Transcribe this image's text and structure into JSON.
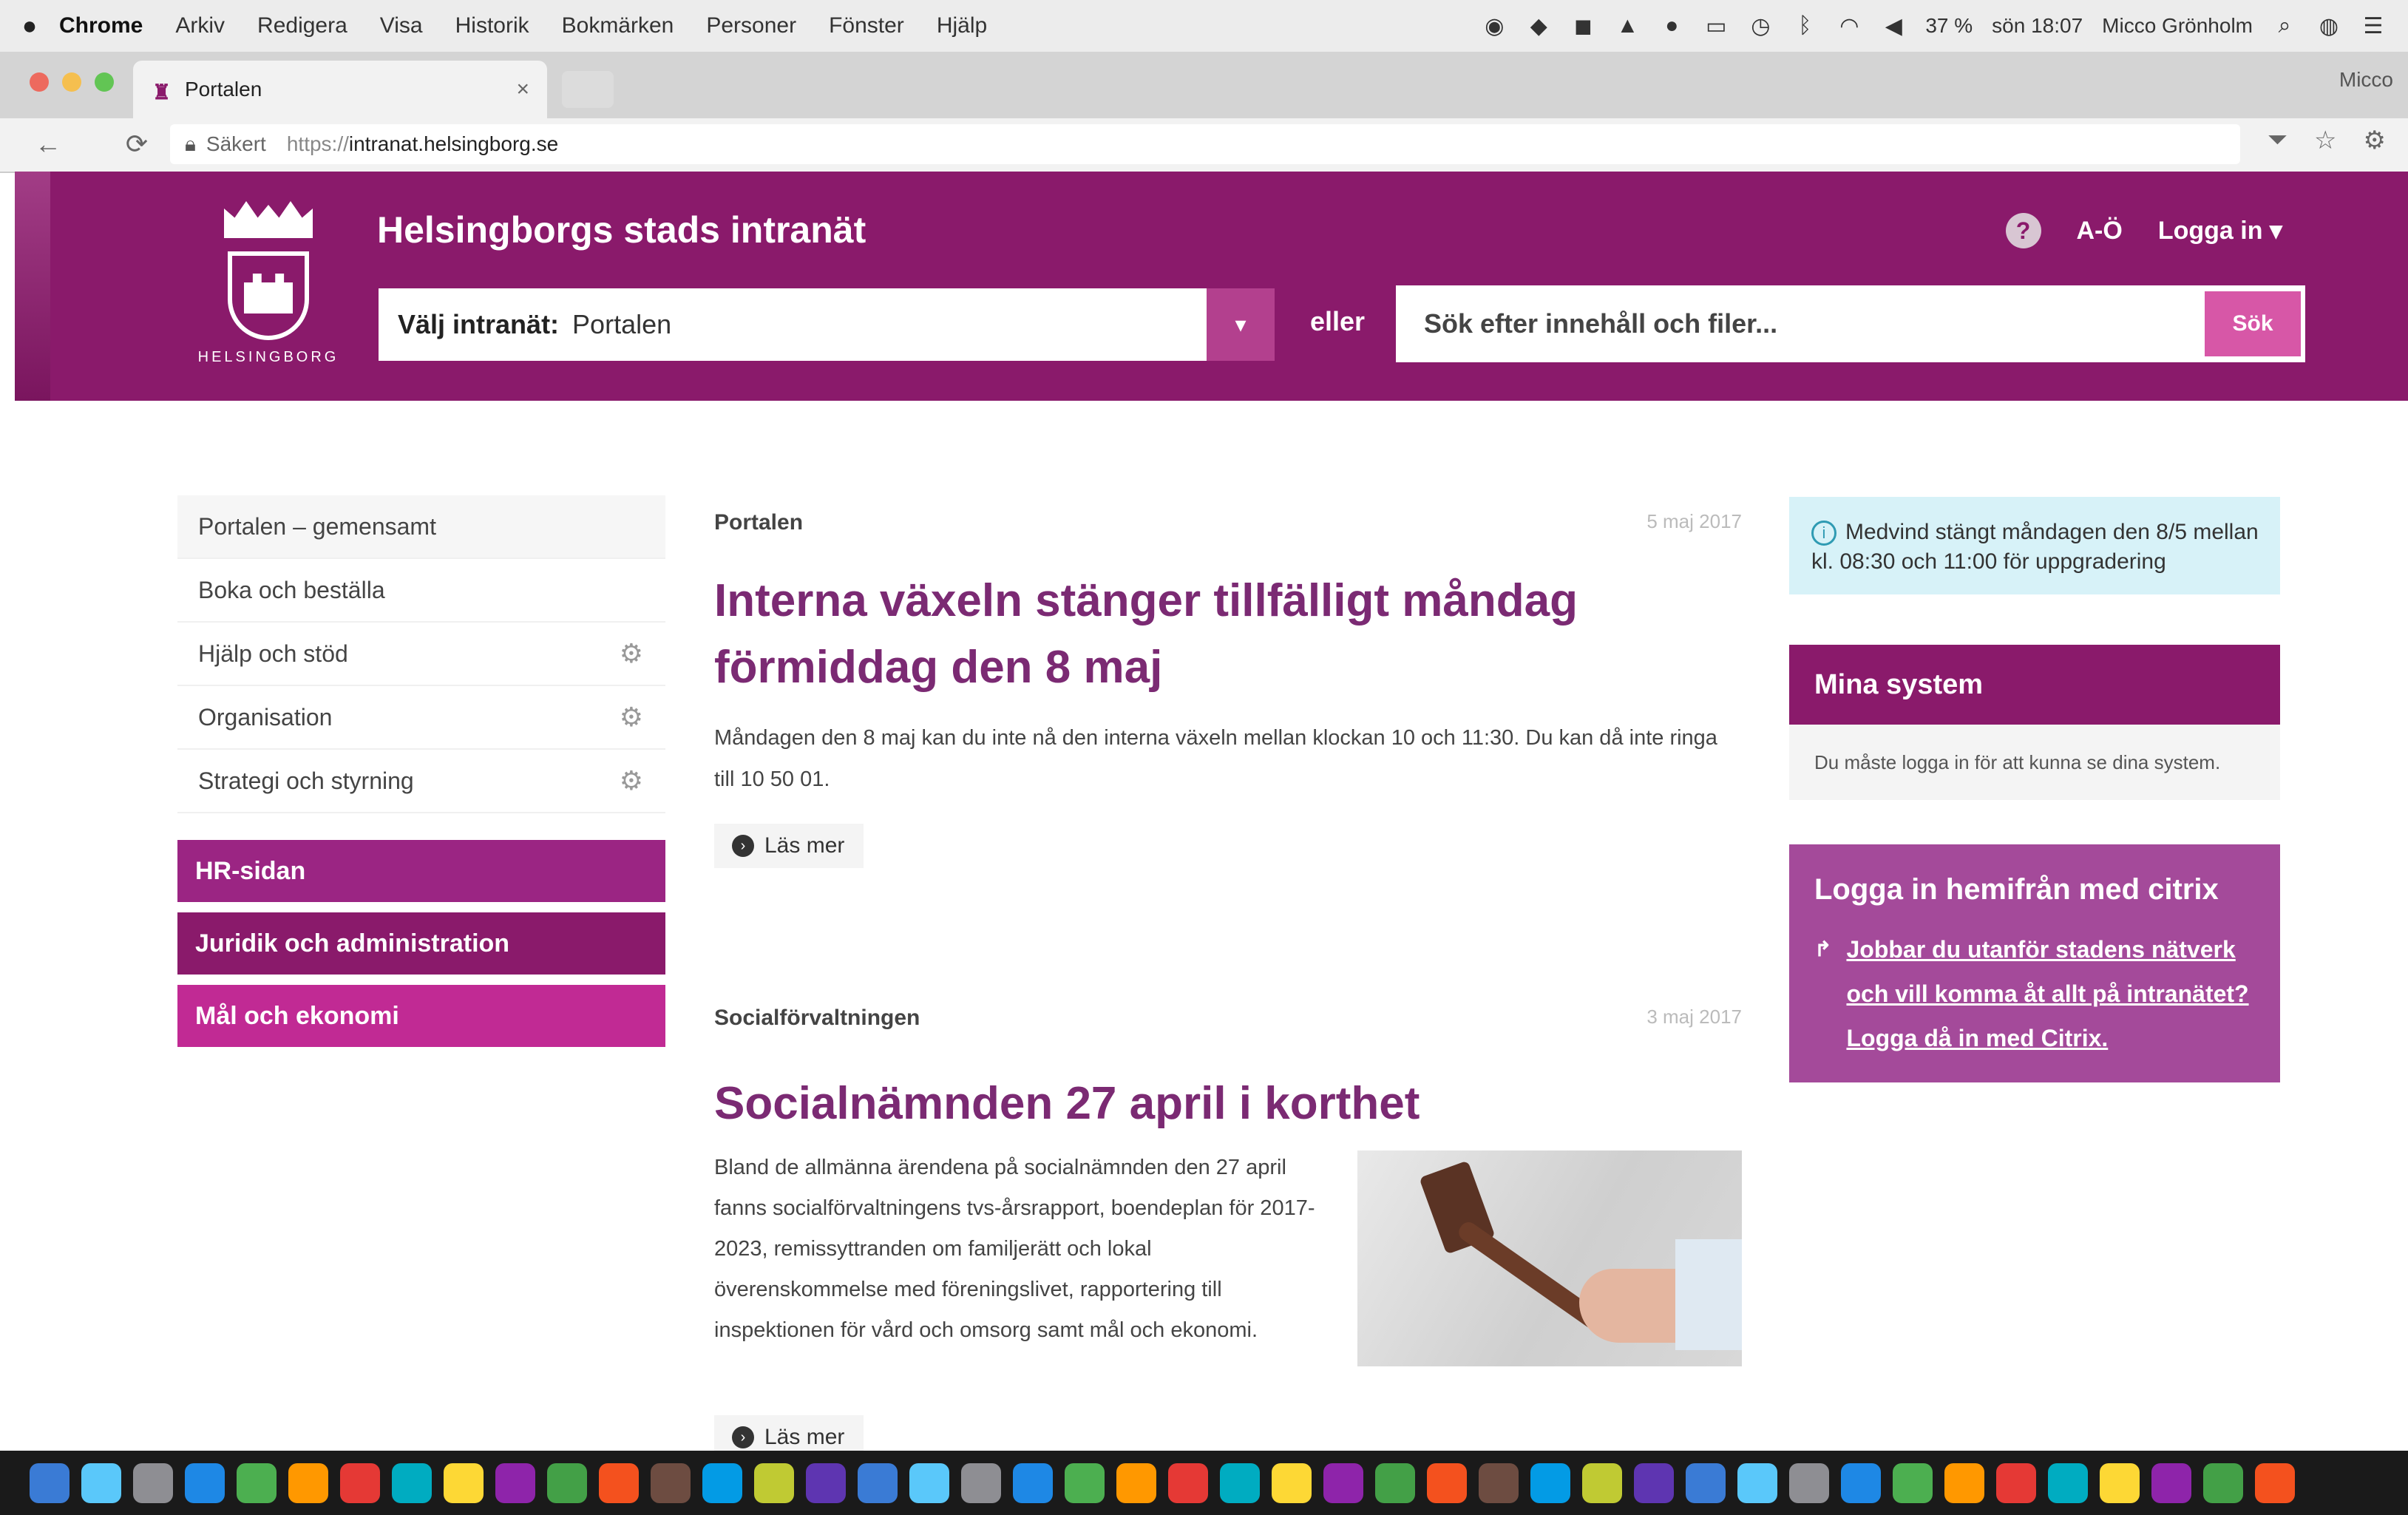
{
  "menubar": {
    "apple": "",
    "app_name": "Chrome",
    "items": [
      "Arkiv",
      "Redigera",
      "Visa",
      "Historik",
      "Bokmärken",
      "Personer",
      "Fönster",
      "Hjälp"
    ],
    "clock": "sön 18:07",
    "user": "Micco Grönholm",
    "battery": "37 %"
  },
  "browser": {
    "tab_title": "Portalen",
    "tab_close": "×",
    "profile": "Micco",
    "back": "←",
    "reload": "⟳",
    "secure_label": "Säkert",
    "url_prefix": "https://",
    "url_host": "intranat.helsingborg.se"
  },
  "header": {
    "logo_text": "HELSINGBORG",
    "site_title": "Helsingborgs stads intranät",
    "help_icon": "?",
    "a_o_label": "A-Ö",
    "login_label": "Logga in ▾",
    "select_label": "Välj intranät:",
    "select_value": "Portalen",
    "select_btn": "▾",
    "or_label": "eller",
    "search_placeholder": "Sök efter innehåll och filer...",
    "search_btn": "Sök"
  },
  "sidebar": {
    "items": [
      {
        "label": "Portalen – gemensamt",
        "gear": false
      },
      {
        "label": "Boka och beställa",
        "gear": false
      },
      {
        "label": "Hjälp och stöd",
        "gear": true
      },
      {
        "label": "Organisation",
        "gear": true
      },
      {
        "label": "Strategi och styrning",
        "gear": true
      }
    ],
    "blocks": [
      "HR-sidan",
      "Juridik och administration",
      "Mål och ekonomi"
    ]
  },
  "articles": [
    {
      "category": "Portalen",
      "date": "5 maj 2017",
      "title": "Interna växeln stänger tillfälligt måndag förmiddag den 8 maj",
      "body": "Måndagen den 8 maj kan du inte nå den interna växeln mellan klockan 10 och 11:30. Du kan då inte ringa till 10 50 01.",
      "read_more": "Läs mer"
    },
    {
      "category": "Socialförvaltningen",
      "date": "3 maj 2017",
      "title": "Socialnämnden 27 april i korthet",
      "body": "Bland de allmänna ärendena på socialnämnden den 27 april fanns socialförvaltningens tvs-årsrapport, boendeplan för 2017-2023, remissyttranden om familjerätt och lokal överenskommelse med föreningslivet, rapportering till inspektionen för vård och omsorg samt mål och ekonomi.",
      "read_more": "Läs mer"
    }
  ],
  "right": {
    "notice_icon": "i",
    "notice": "Medvind stängt måndagen den 8/5 mellan kl. 08:30 och 11:00 för uppgradering",
    "mina_title": "Mina system",
    "mina_body": "Du måste logga in för att kunna se dina system.",
    "citrix_title": "Logga in hemifrån med citrix",
    "citrix_link": "Jobbar du utanför stadens nätverk och vill komma åt allt på intranätet? Logga då in med Citrix.",
    "citrix_icon": "↱"
  },
  "colors": {
    "brand": "#8a1a6b",
    "accent": "#d757a7",
    "title": "#7b2a73"
  },
  "dock_icons": [
    "finder-icon",
    "siri-icon",
    "launchpad-icon",
    "safari-icon",
    "mail-icon",
    "photos-icon",
    "skype-icon",
    "messages-icon",
    "chrome-icon",
    "itunes-icon",
    "firefox-icon",
    "app-icon",
    "app-icon",
    "app-icon",
    "app-icon",
    "app-icon",
    "app-icon",
    "app-icon",
    "app-icon",
    "app-icon",
    "app-icon",
    "app-icon",
    "app-icon",
    "app-icon",
    "app-icon",
    "app-icon",
    "app-icon",
    "app-icon",
    "app-icon",
    "app-icon",
    "app-icon",
    "app-icon",
    "app-icon",
    "app-icon",
    "app-icon",
    "app-icon",
    "app-icon",
    "app-icon",
    "app-icon",
    "app-icon",
    "app-icon",
    "app-icon",
    "app-icon",
    "trash-icon"
  ]
}
